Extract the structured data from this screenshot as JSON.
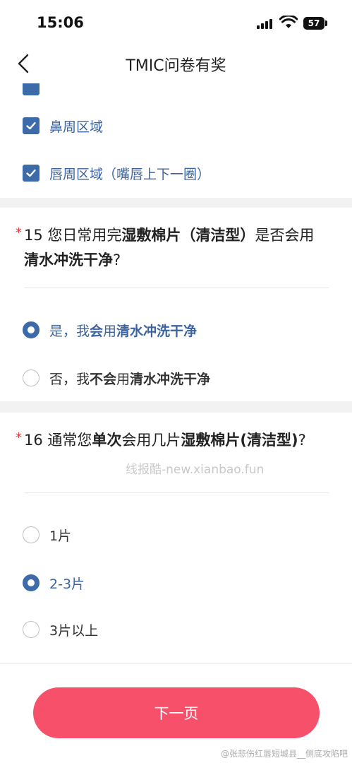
{
  "status": {
    "time": "15:06",
    "battery": "57"
  },
  "nav": {
    "title": "TMIC问卷有奖"
  },
  "q14": {
    "options": [
      {
        "label": "鼻周区域",
        "checked": true
      },
      {
        "label": "唇周区域（嘴唇上下一圈）",
        "checked": true
      }
    ]
  },
  "q15": {
    "required": "*",
    "title_parts": [
      "15 您日常用完",
      "湿敷棉片（清洁型）",
      "是否会用",
      "清水冲洗干净",
      "?"
    ],
    "options": [
      {
        "parts": [
          "是，我",
          "会",
          "用",
          "清水冲洗干净"
        ],
        "selected": true
      },
      {
        "parts": [
          "否，我",
          "不会",
          "用",
          "清水冲洗干净"
        ],
        "selected": false
      }
    ]
  },
  "q16": {
    "required": "*",
    "title_parts": [
      "16 通常您",
      "单次",
      "会用几片",
      "湿敷棉片(清洁型)",
      "?"
    ],
    "options": [
      {
        "label": "1片",
        "selected": false
      },
      {
        "label": "2-3片",
        "selected": true
      },
      {
        "label": "3片以上",
        "selected": false
      }
    ]
  },
  "watermark": "线报酷-new.xianbao.fun",
  "footer": {
    "next_label": "下一页",
    "source_watermark": "@张悲伤红唇短城县__侧底攻陷吧"
  },
  "colors": {
    "accent": "#3d6aa8",
    "button": "#f7506a",
    "required": "#e03a3a"
  },
  "icons": [
    "back-chevron-icon",
    "signal-icon",
    "wifi-icon",
    "battery-icon",
    "checkmark-icon"
  ]
}
